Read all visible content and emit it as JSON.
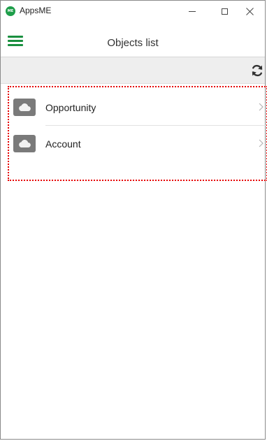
{
  "window": {
    "app_title": "AppsME",
    "logo_text": "ME",
    "controls": [
      "minimize-icon",
      "maximize-icon",
      "close-icon"
    ]
  },
  "header": {
    "title": "Objects list",
    "menu_icon": "hamburger-menu-icon"
  },
  "toolbar": {
    "refresh_icon": "refresh-icon"
  },
  "list": {
    "items": [
      {
        "label": "Opportunity",
        "icon": "cloud-icon"
      },
      {
        "label": "Account",
        "icon": "cloud-icon"
      }
    ]
  },
  "colors": {
    "accent": "#1a8f3f",
    "icon_bg": "#7a7a7a",
    "toolbar_bg": "#eeeeee",
    "highlight_border": "#e60000"
  }
}
